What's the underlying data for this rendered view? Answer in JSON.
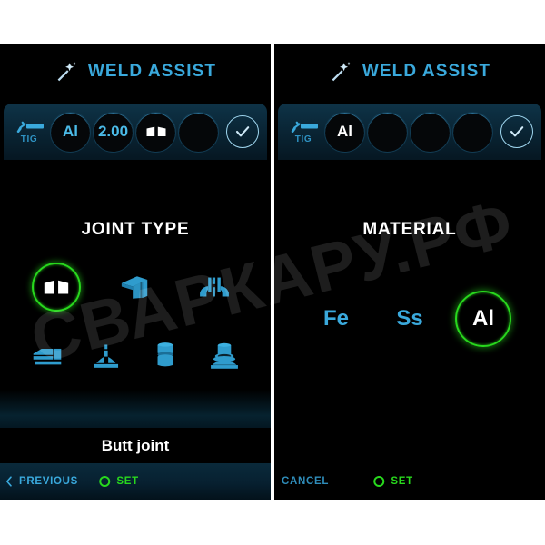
{
  "app": {
    "title": "WELD ASSIST",
    "wand_icon": "magic-wand-icon",
    "accent_blue": "#3aa9dc",
    "accent_green": "#28d81d",
    "background": "#000000"
  },
  "watermark": {
    "text": "СВАРКАРУ.РФ"
  },
  "left_panel": {
    "header_title": "WELD ASSIST",
    "stepbar": {
      "mode_icon": "welding-torch-icon",
      "mode_label": "TIG",
      "steps": [
        {
          "label": "Al",
          "state": "done",
          "icon": ""
        },
        {
          "label": "2.00",
          "state": "done",
          "icon": ""
        },
        {
          "label": "",
          "state": "active",
          "icon": "butt-joint-icon"
        },
        {
          "label": "",
          "state": "empty",
          "icon": ""
        }
      ],
      "confirm_icon": "checkmark-icon"
    },
    "section_title": "JOINT TYPE",
    "joint_types": [
      {
        "id": "butt-joint",
        "label": "Butt joint",
        "selected": true
      },
      {
        "id": "corner-joint",
        "label": "Corner joint",
        "selected": false
      },
      {
        "id": "edge-joint",
        "label": "Edge joint",
        "selected": false
      },
      {
        "id": "lap-joint",
        "label": "Lap joint",
        "selected": false
      },
      {
        "id": "tee-joint",
        "label": "T joint",
        "selected": false
      },
      {
        "id": "pipe-butt-joint",
        "label": "Pipe butt joint",
        "selected": false
      },
      {
        "id": "pipe-to-plate-joint",
        "label": "Pipe to plate joint",
        "selected": false
      }
    ],
    "selection_label": "Butt joint",
    "footer": {
      "previous_label": "PREVIOUS",
      "set_label": "SET"
    }
  },
  "right_panel": {
    "header_title": "WELD ASSIST",
    "stepbar": {
      "mode_icon": "welding-torch-icon",
      "mode_label": "TIG",
      "steps": [
        {
          "label": "Al",
          "state": "active",
          "icon": ""
        },
        {
          "label": "",
          "state": "empty",
          "icon": ""
        },
        {
          "label": "",
          "state": "empty",
          "icon": ""
        },
        {
          "label": "",
          "state": "empty",
          "icon": ""
        }
      ],
      "confirm_icon": "checkmark-icon"
    },
    "section_title": "MATERIAL",
    "materials": [
      {
        "id": "fe",
        "label": "Fe",
        "selected": false
      },
      {
        "id": "ss",
        "label": "Ss",
        "selected": false
      },
      {
        "id": "al",
        "label": "Al",
        "selected": true
      }
    ],
    "footer": {
      "cancel_label": "CANCEL",
      "set_label": "SET"
    }
  }
}
